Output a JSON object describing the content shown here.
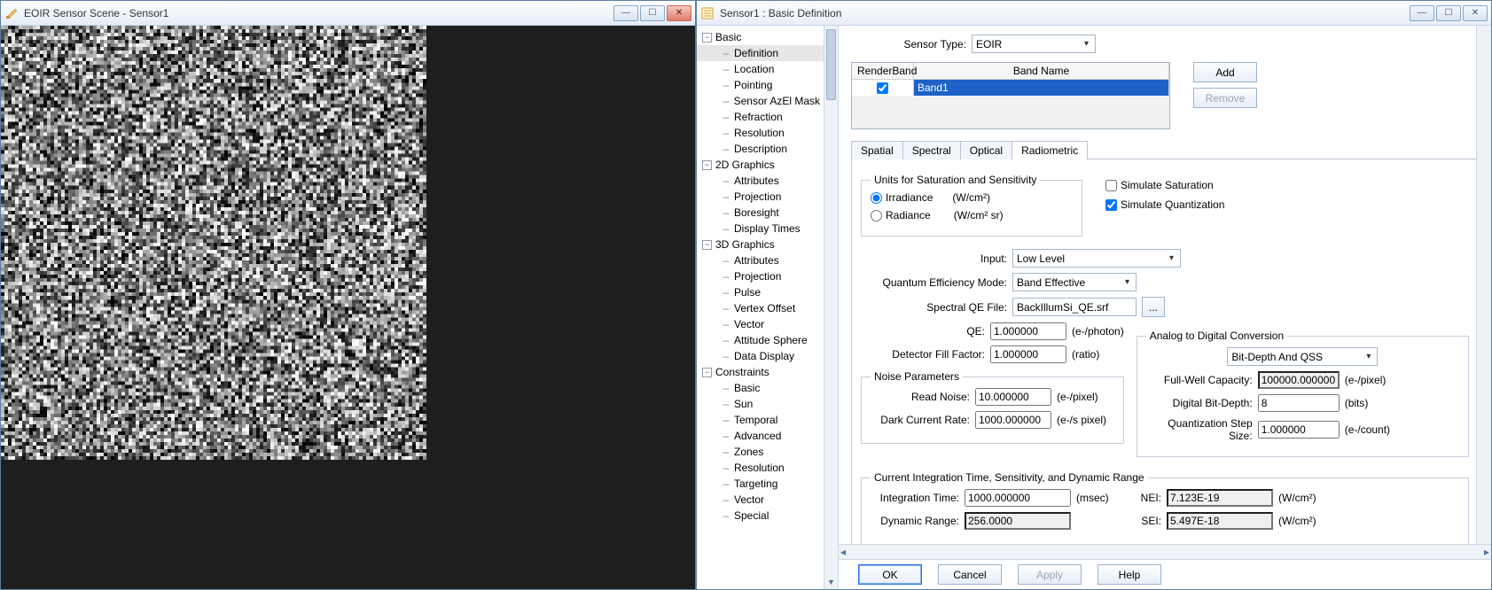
{
  "leftWindow": {
    "title": "EOIR Sensor Scene - Sensor1"
  },
  "rightWindow": {
    "title": "Sensor1 : Basic Definition"
  },
  "tree": {
    "groups": [
      {
        "label": "Basic",
        "expanded": true,
        "children": [
          "Definition",
          "Location",
          "Pointing",
          "Sensor AzEl Mask",
          "Refraction",
          "Resolution",
          "Description"
        ],
        "selected": "Definition"
      },
      {
        "label": "2D Graphics",
        "expanded": true,
        "children": [
          "Attributes",
          "Projection",
          "Boresight",
          "Display Times"
        ]
      },
      {
        "label": "3D Graphics",
        "expanded": true,
        "children": [
          "Attributes",
          "Projection",
          "Pulse",
          "Vertex Offset",
          "Vector",
          "Attitude Sphere",
          "Data Display"
        ]
      },
      {
        "label": "Constraints",
        "expanded": true,
        "children": [
          "Basic",
          "Sun",
          "Temporal",
          "Advanced",
          "Zones",
          "Resolution",
          "Targeting",
          "Vector",
          "Special"
        ]
      }
    ]
  },
  "sensorType": {
    "label": "Sensor Type:",
    "value": "EOIR"
  },
  "bandTable": {
    "colRender": "RenderBand",
    "colName": "Band Name",
    "rowChecked": true,
    "rowName": "Band1",
    "addBtn": "Add",
    "removeBtn": "Remove"
  },
  "tabs": {
    "spatial": "Spatial",
    "spectral": "Spectral",
    "optical": "Optical",
    "radiometric": "Radiometric"
  },
  "units": {
    "legend": "Units for Saturation and Sensitivity",
    "irradiance": "Irradiance",
    "irrUnit": "(W/cm²)",
    "radiance": "Radiance",
    "radUnit": "(W/cm² sr)"
  },
  "simSat": "Simulate Saturation",
  "simQuant": "Simulate Quantization",
  "inputLbl": "Input:",
  "inputVal": "Low Level",
  "qemLbl": "Quantum Efficiency Mode:",
  "qemVal": "Band Effective",
  "qeFileLbl": "Spectral QE File:",
  "qeFileVal": "BackIllumSi_QE.srf",
  "browse": "...",
  "qeLbl": "QE:",
  "qeVal": "1.000000",
  "qeUnit": "(e-/photon)",
  "dffLbl": "Detector Fill Factor:",
  "dffVal": "1.000000",
  "dffUnit": "(ratio)",
  "noiseLegend": "Noise Parameters",
  "readLbl": "Read Noise:",
  "readVal": "10.000000",
  "readUnit": "(e-/pixel)",
  "darkLbl": "Dark Current Rate:",
  "darkVal": "1000.000000",
  "darkUnit": "(e-/s pixel)",
  "adcLegend": "Analog to Digital Conversion",
  "adcModeVal": "Bit-Depth And QSS",
  "fwcLbl": "Full-Well Capacity:",
  "fwcVal": "100000.000000",
  "fwcUnit": "(e-/pixel)",
  "bitLbl": "Digital Bit-Depth:",
  "bitVal": "8",
  "bitUnit": "(bits)",
  "qssLbl": "Quantization Step Size:",
  "qssVal": "1.000000",
  "qssUnit": "(e-/count)",
  "curLegend": "Current Integration Time, Sensitivity, and Dynamic Range",
  "intLbl": "Integration Time:",
  "intVal": "1000.000000",
  "intUnit": "(msec)",
  "drLbl": "Dynamic Range:",
  "drVal": "256.0000",
  "neiLbl": "NEI:",
  "neiVal": "7.123E-19",
  "neiUnit": "(W/cm²)",
  "seiLbl": "SEI:",
  "seiVal": "5.497E-18",
  "seiUnit": "(W/cm²)",
  "footer": {
    "ok": "OK",
    "cancel": "Cancel",
    "apply": "Apply",
    "help": "Help"
  }
}
